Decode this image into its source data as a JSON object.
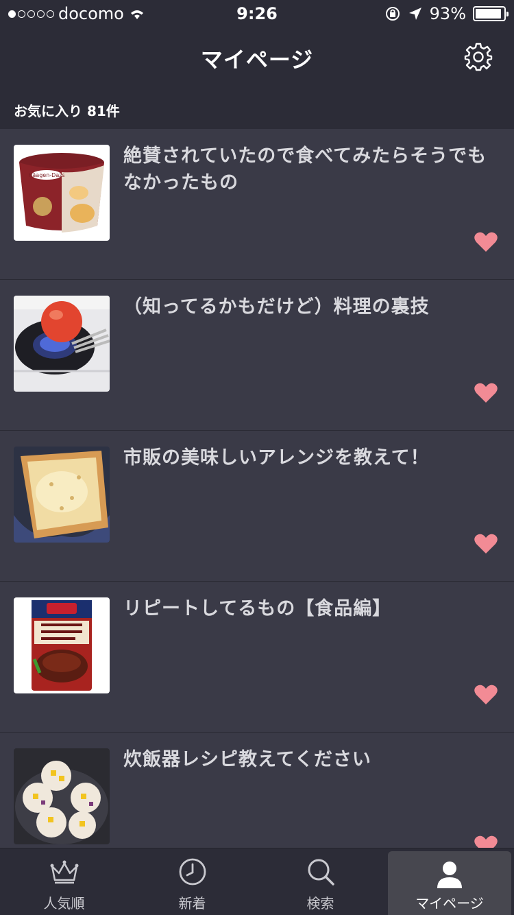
{
  "status": {
    "carrier": "docomo",
    "time": "9:26",
    "battery": "93%",
    "battery_level": 0.93
  },
  "header": {
    "title": "マイページ"
  },
  "section": {
    "label": "お気に入り 81件"
  },
  "items": [
    {
      "title": "絶賛されていたので食べてみたらそうでもなかったもの",
      "thumbnail": "ice-cream-cup",
      "favorited": true
    },
    {
      "title": "（知ってるかもだけど）料理の裏技",
      "thumbnail": "tomato-on-stove",
      "favorited": true
    },
    {
      "title": "市販の美味しいアレンジを教えて！",
      "thumbnail": "cheese-toast",
      "favorited": true
    },
    {
      "title": "リピートしてるもの【食品編】",
      "thumbnail": "hamburg-sauce-pack",
      "favorited": true
    },
    {
      "title": "炊飯器レシピ教えてください",
      "thumbnail": "rice-cooker-cakes",
      "favorited": true
    }
  ],
  "tabs": [
    {
      "label": "人気順",
      "icon": "crown-icon",
      "active": false
    },
    {
      "label": "新着",
      "icon": "clock-icon",
      "active": false
    },
    {
      "label": "検索",
      "icon": "search-icon",
      "active": false
    },
    {
      "label": "マイページ",
      "icon": "person-icon",
      "active": true
    }
  ],
  "colors": {
    "background": "#3a3a47",
    "bar": "#2c2c37",
    "heart": "#f28b95",
    "text": "#d9d9de"
  }
}
